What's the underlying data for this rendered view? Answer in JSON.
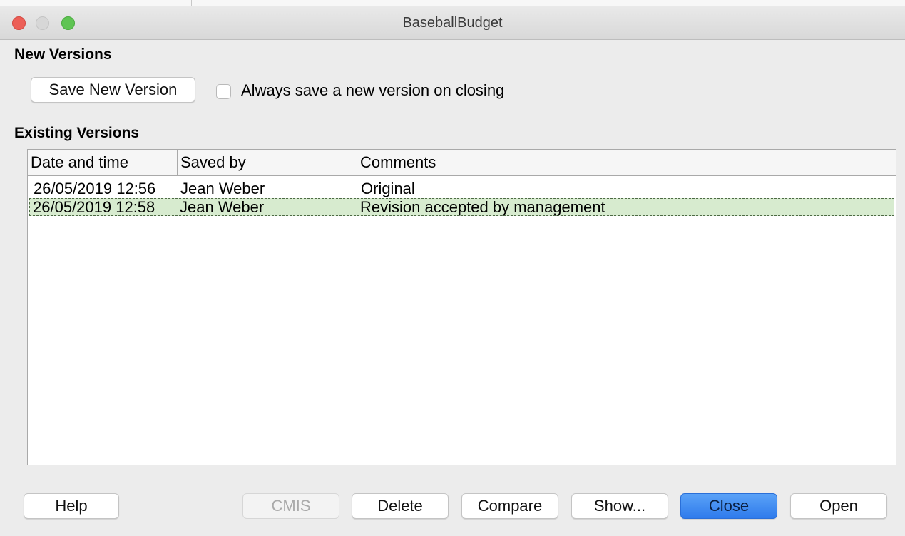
{
  "window": {
    "title": "BaseballBudget"
  },
  "new_versions": {
    "heading": "New Versions",
    "save_button": "Save New Version",
    "checkbox_label": "Always save a new version on closing",
    "checkbox_checked": false
  },
  "existing_versions": {
    "heading": "Existing Versions",
    "columns": [
      "Date and time",
      "Saved by",
      "Comments"
    ],
    "rows": [
      {
        "date": "26/05/2019 12:56",
        "saved_by": "Jean Weber",
        "comment": "Original",
        "selected": false
      },
      {
        "date": "26/05/2019 12:58",
        "saved_by": "Jean Weber",
        "comment": "Revision accepted by management",
        "selected": true
      }
    ]
  },
  "buttons": {
    "help": "Help",
    "cmis": "CMIS",
    "delete": "Delete",
    "compare": "Compare",
    "show": "Show...",
    "close": "Close",
    "open": "Open"
  },
  "colors": {
    "selection": "#d7ebcf",
    "primary_button": "#2f7bec"
  }
}
